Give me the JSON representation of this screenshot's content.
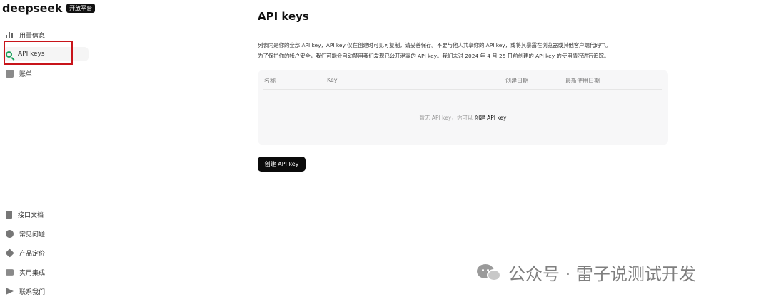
{
  "brand": {
    "name": "deepseek",
    "badge": "开放平台"
  },
  "sidebar": {
    "top_items": [
      {
        "label": "用量信息",
        "icon": "bar-chart-icon"
      },
      {
        "label": "API keys",
        "icon": "search-icon",
        "active": true
      },
      {
        "label": "账单",
        "icon": "billing-icon"
      }
    ],
    "bottom_items": [
      {
        "label": "接口文档",
        "icon": "document-icon"
      },
      {
        "label": "常见问题",
        "icon": "question-icon"
      },
      {
        "label": "产品定价",
        "icon": "tag-icon"
      },
      {
        "label": "实用集成",
        "icon": "layers-icon"
      },
      {
        "label": "联系我们",
        "icon": "paper-plane-icon"
      }
    ]
  },
  "main": {
    "title": "API keys",
    "description_line1": "列表内是你的全部 API key，API key 仅在创建时可见可复制，请妥善保存。不要与他人共享你的 API key，或将其暴露在浏览器或其他客户端代码中。",
    "description_line2": "为了保护你的帐户安全，我们可能会自动禁用我们发现已公开泄露的 API key。我们未对 2024 年 4 月 25 日前创建的 API key 的使用情况进行追踪。",
    "table": {
      "columns": [
        "名称",
        "Key",
        "创建日期",
        "最新使用日期"
      ],
      "empty_text": "暂无 API key，你可以",
      "empty_link": "创建 API key"
    },
    "create_button": "创建 API key"
  },
  "watermark": {
    "text": "公众号 · 雷子说测试开发"
  },
  "colors": {
    "accent_green": "#19a05a",
    "highlight_red": "#c8141a",
    "button_bg": "#0b0b0b"
  }
}
